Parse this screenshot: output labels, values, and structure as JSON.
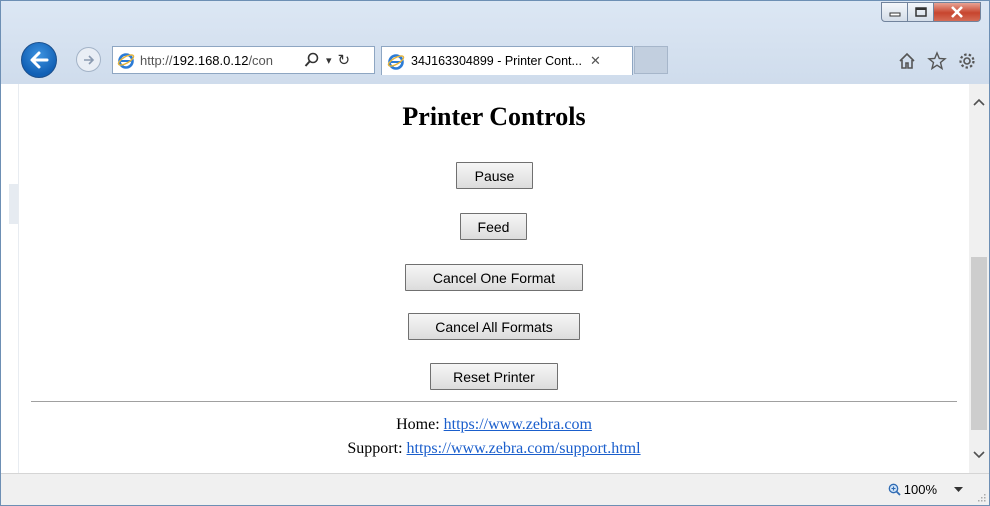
{
  "browser": {
    "address": {
      "url_prefix": "http://",
      "url_host": "192.168.0.12",
      "url_rest": "/con",
      "search_glyph": "⌕",
      "dropdown_glyph": "▾",
      "refresh_glyph": "↻"
    },
    "tab": {
      "title": "34J163304899 - Printer Cont...",
      "close_glyph": "✕"
    },
    "icons": [
      "back-arrow-icon",
      "forward-arrow-icon",
      "ie-logo-icon",
      "search-icon",
      "dropdown-icon",
      "refresh-icon",
      "home-icon",
      "favorites-star-icon",
      "settings-gear-icon",
      "minimize-icon",
      "maximize-icon",
      "close-icon"
    ]
  },
  "page": {
    "title": "Printer Controls",
    "buttons": {
      "pause": "Pause",
      "feed": "Feed",
      "cancel_one": "Cancel One Format",
      "cancel_all": "Cancel All Formats",
      "reset": "Reset Printer"
    },
    "footer": {
      "home_label": "Home: ",
      "home_link": "https://www.zebra.com",
      "support_label": "Support: ",
      "support_link": "https://www.zebra.com/support.html"
    }
  },
  "statusbar": {
    "zoom": "100%"
  },
  "colors": {
    "link": "#1a5ecc",
    "close_button": "#c7452e",
    "back_button": "#1160b5"
  }
}
